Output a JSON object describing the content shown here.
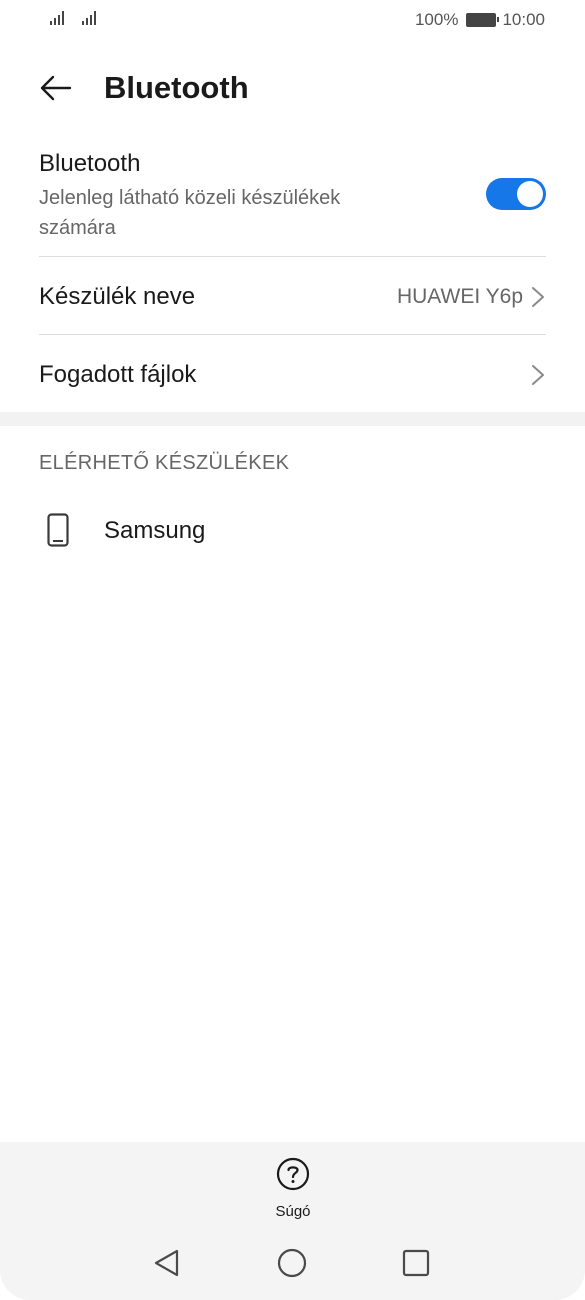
{
  "status_bar": {
    "battery_percent": "100%",
    "time": "10:00"
  },
  "header": {
    "title": "Bluetooth"
  },
  "bluetooth_row": {
    "label": "Bluetooth",
    "description": "Jelenleg látható közeli készülékek számára",
    "enabled": true
  },
  "device_name_row": {
    "label": "Készülék neve",
    "value": "HUAWEI Y6p"
  },
  "received_files_row": {
    "label": "Fogadott fájlok"
  },
  "available_devices": {
    "section_title": "ELÉRHETŐ KÉSZÜLÉKEK",
    "items": [
      {
        "name": "Samsung",
        "icon": "phone-icon"
      }
    ]
  },
  "help": {
    "label": "Súgó"
  },
  "colors": {
    "accent": "#1677e8"
  }
}
